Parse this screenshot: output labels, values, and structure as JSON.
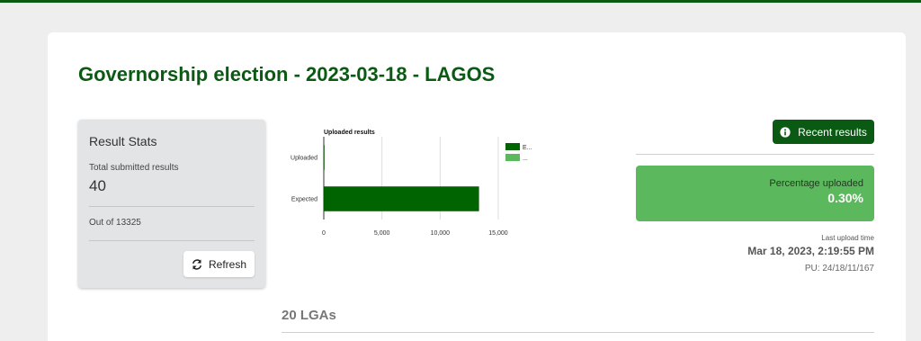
{
  "page": {
    "title": "Governorship election - 2023-03-18 - LAGOS"
  },
  "stats": {
    "title": "Result Stats",
    "submitted_label": "Total submitted results",
    "submitted_value": "40",
    "out_of": "Out of 13325",
    "refresh_label": "Refresh"
  },
  "chart_data": {
    "type": "bar",
    "orientation": "horizontal",
    "title": "Uploaded results",
    "categories": [
      "Uploaded",
      "Expected"
    ],
    "values": [
      40,
      13325
    ],
    "xlim": [
      0,
      15000
    ],
    "xticks": [
      0,
      5000,
      10000,
      15000
    ],
    "xtick_labels": [
      "0",
      "5,000",
      "10,000",
      "15,000"
    ],
    "legend": [
      "E...",
      "..."
    ],
    "legend_colors": [
      "#006400",
      "#5cb85c"
    ],
    "legend_position": "right",
    "grid": true
  },
  "recent": {
    "label": "Recent results"
  },
  "progress": {
    "label": "Percentage uploaded",
    "value": "0.30%"
  },
  "upload": {
    "label": "Last upload time",
    "time": "Mar 18, 2023, 2:19:55 PM",
    "pu": "PU: 24/18/11/167"
  },
  "lga": {
    "heading": "20 LGAs"
  },
  "colors": {
    "brand": "#0b5a14",
    "bar": "#006400",
    "accent": "#5cb85c"
  }
}
